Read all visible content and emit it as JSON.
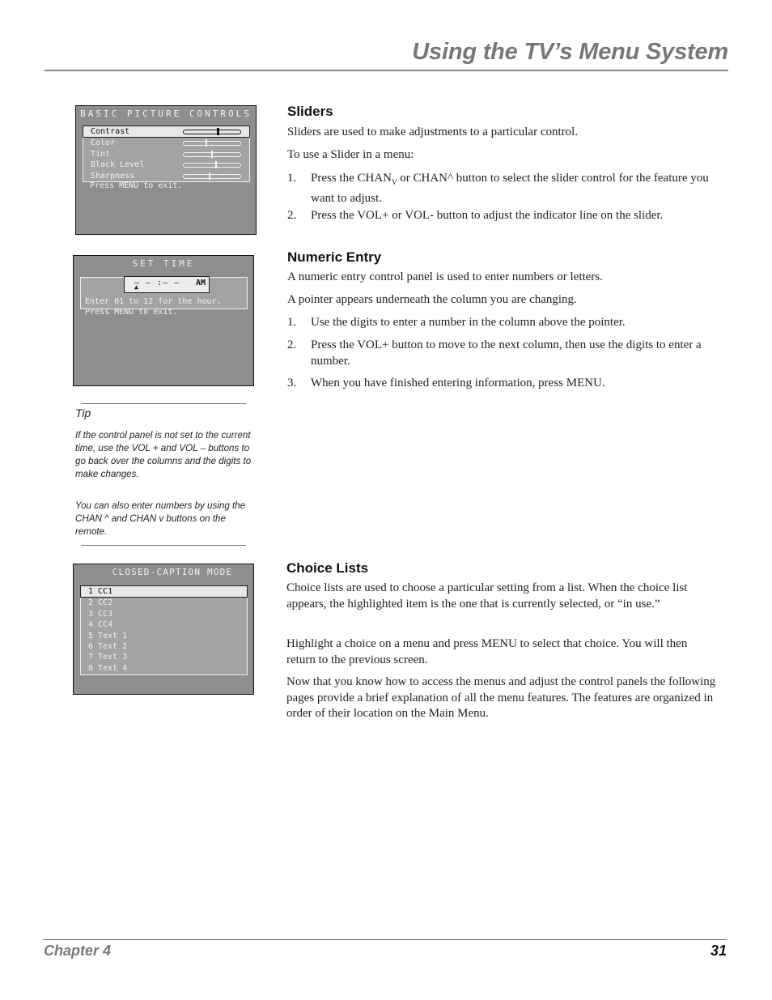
{
  "header": {
    "title": "Using the TV’s Menu System"
  },
  "footer": {
    "chapter": "Chapter 4",
    "page": "31"
  },
  "screens": {
    "basic_picture": {
      "title": "BASIC PICTURE CONTROLS",
      "items": [
        {
          "label": "Contrast",
          "value": 0.6,
          "selected": true
        },
        {
          "label": "Color",
          "value": 0.4,
          "selected": false
        },
        {
          "label": "Tint",
          "value": 0.5,
          "selected": false
        },
        {
          "label": "Black Level",
          "value": 0.57,
          "selected": false
        },
        {
          "label": "Sharpness",
          "value": 0.46,
          "selected": false
        }
      ],
      "note": "Press MENU to exit."
    },
    "set_time": {
      "title": "SET TIME",
      "entry": "— — :— —",
      "ampm": "AM",
      "pointer": "▲",
      "note1": "Enter 01 to 12 for the hour.",
      "note2": "Press MENU to exit."
    },
    "closed_caption": {
      "title": "CLOSED-CAPTION MODE",
      "items": [
        {
          "label": "1 CC1",
          "selected": true
        },
        {
          "label": "2 CC2",
          "selected": false
        },
        {
          "label": "3 CC3",
          "selected": false
        },
        {
          "label": "4 CC4",
          "selected": false
        },
        {
          "label": "5 Text 1",
          "selected": false
        },
        {
          "label": "6 Text 2",
          "selected": false
        },
        {
          "label": "7 Text 3",
          "selected": false
        },
        {
          "label": "8 Text 4",
          "selected": false
        }
      ]
    }
  },
  "tip": {
    "heading": "Tip",
    "para1": "If the control panel is not set to the current time, use the VOL + and VOL – buttons to go back over the columns and the digits to make changes.",
    "para2": "You can also enter numbers by using the CHAN ^ and CHAN v buttons on the remote."
  },
  "sliders": {
    "heading": "Sliders",
    "p1": "Sliders are used to make adjustments to a particular control.",
    "p2": "To use a Slider in a menu:",
    "steps": [
      {
        "num": "1.",
        "text_a": "Press the CHAN",
        "sub": "V",
        "text_b": " or CHAN^ button to select the slider control for the feature you want to adjust."
      },
      {
        "num": "2.",
        "text": "Press the VOL+ or VOL- button to adjust the indicator line on the slider."
      }
    ]
  },
  "numeric": {
    "heading": "Numeric Entry",
    "p1": "A numeric entry control panel is used to enter numbers or letters.",
    "p2": "A pointer appears underneath the column you are changing.",
    "steps": [
      {
        "num": "1.",
        "text": "Use the digits to enter a number in the column above the pointer."
      },
      {
        "num": "2.",
        "text": "Press the VOL+ button to move to the next column, then use the digits to enter a number."
      },
      {
        "num": "3.",
        "text": "When you have finished entering information, press MENU."
      }
    ]
  },
  "choice": {
    "heading": "Choice Lists",
    "p1": "Choice lists are used to choose a particular setting from a list. When the choice list appears, the highlighted item is the one that is currently selected, or “in use.”",
    "p2": "Highlight a choice on a menu and press MENU to select that choice. You will then return to the previous screen.",
    "p3": "Now that you know how to access the menus and adjust the control panels the following pages provide a brief explanation of all the menu features. The features are organized in order of their location on the Main Menu."
  }
}
